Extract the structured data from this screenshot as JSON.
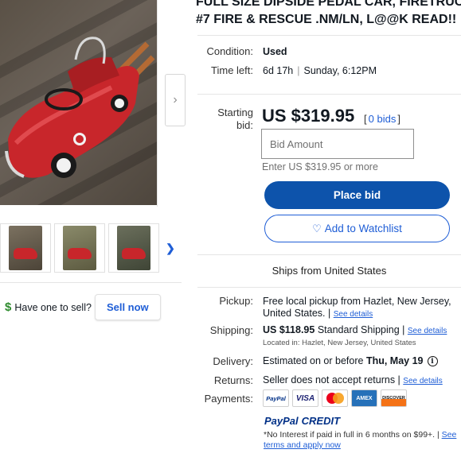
{
  "listing": {
    "title_line1": "FULL SIZE DIPSIDE PEDAL CAR, FIRETRUCK",
    "title_line2": "#7 FIRE & RESCUE .NM/LN, L@@K READ!!"
  },
  "gallery": {
    "next_icon": "chevron-right-icon",
    "thumbnails": [
      "thumbnail-1",
      "thumbnail-2",
      "thumbnail-3"
    ]
  },
  "sell": {
    "prompt": "Have one to sell?",
    "button": "Sell now",
    "icon": "dollar-icon"
  },
  "condition": {
    "label": "Condition:",
    "value": "Used"
  },
  "time_left": {
    "label": "Time left:",
    "remaining": "6d 17h",
    "separator": "|",
    "end": "Sunday, 6:12PM"
  },
  "bid": {
    "label_line1": "Starting",
    "label_line2": "bid:",
    "price": "US $319.95",
    "bids_open": "[",
    "bids_link": "0 bids",
    "bids_close": "]",
    "input_placeholder": "Bid Amount",
    "hint": "Enter US $319.95 or more",
    "place_bid_button": "Place bid",
    "watchlist_button": "Add to Watchlist",
    "watchlist_icon": "♡"
  },
  "ships_from": "Ships from United States",
  "pickup": {
    "label": "Pickup:",
    "line1": "Free local pickup from Hazlet, New Jersey,",
    "line2": "United States. |",
    "link": "See details"
  },
  "shipping": {
    "label": "Shipping:",
    "amount": "US $118.95",
    "service": "Standard Shipping |",
    "link": "See details",
    "location": "Located in: Hazlet, New Jersey, United States"
  },
  "delivery": {
    "label": "Delivery:",
    "text": "Estimated on or before",
    "date": "Thu, May 19",
    "info_icon": "i"
  },
  "returns": {
    "label": "Returns:",
    "text": "Seller does not accept returns |",
    "link": "See details"
  },
  "payments": {
    "label": "Payments:",
    "methods": [
      "PayPal",
      "VISA",
      "Mastercard",
      "AMEX",
      "DISCOVER"
    ],
    "paypal_credit_pay": "PayPal",
    "paypal_credit_credit": "CREDIT",
    "fine_print": "*No Interest if paid in full in 6 months on $99+. |",
    "fine_print_link": "See terms and apply now"
  },
  "colors": {
    "primary_blue": "#0d53ab",
    "link_blue": "#1f5ed6",
    "text": "#111820",
    "car_red": "#c8262b"
  }
}
